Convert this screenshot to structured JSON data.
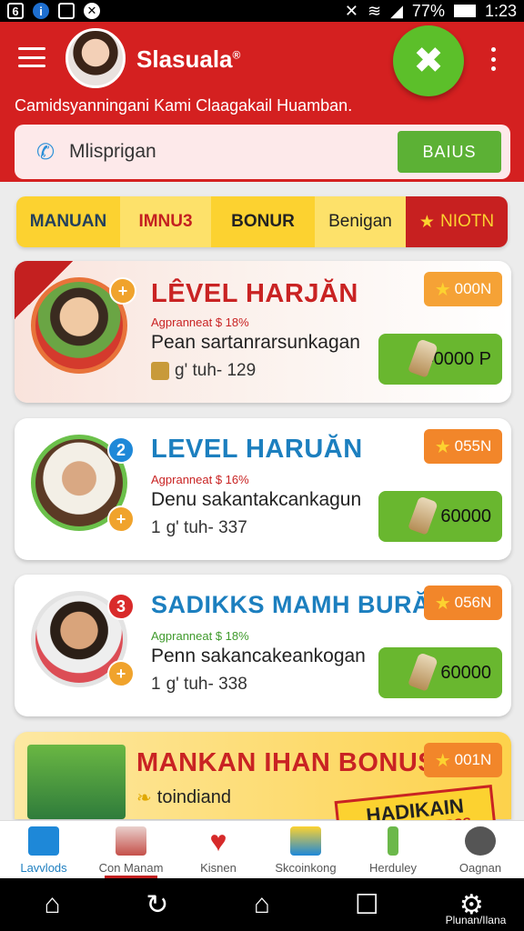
{
  "status_bar": {
    "left_icons": [
      "sim-icon",
      "info-icon",
      "gallery-icon",
      "close-circle-icon"
    ],
    "battery": "77%",
    "time": "1:23"
  },
  "header": {
    "app_title": "Slasuala",
    "app_title_mark": "®",
    "tagline": "Camidsyanningani Kami Claagakail Huamban.",
    "search_value": "Mlisprigan",
    "search_button": "BAIUS"
  },
  "tabs": [
    {
      "label": "MANUAN"
    },
    {
      "label": "IMNU3"
    },
    {
      "label": "BONUR"
    },
    {
      "label": "Benigan"
    },
    {
      "label": "NIOTN",
      "icon": "star-icon"
    }
  ],
  "cards": [
    {
      "title": "LÊVEL HARJĂN",
      "badge": "+",
      "subtitle": "Agpranneat $ 18%",
      "description": "Pean sartanrarsunkagan",
      "meta": "g' tuh- 129",
      "star_pill": "000N",
      "price": "40000 P"
    },
    {
      "title": "LEVEL HARUĂN",
      "badge": "2",
      "badge2": "+",
      "subtitle": "Agpranneat $ 16%",
      "description": "Denu sakantakcankagun",
      "meta_prefix": "1",
      "meta": "g' tuh- 337",
      "star_pill": "055N",
      "price": "60000"
    },
    {
      "title": "SADIKKS MAMH BURĂN",
      "badge": "3",
      "badge2": "+",
      "subtitle": "Agpranneat $ 18%",
      "description": "Penn sakancakeankogan",
      "meta_prefix": "1",
      "meta": "g' tuh- 338",
      "star_pill": "056N",
      "price": "60000"
    },
    {
      "title": "MANKAN IHAN BONUS",
      "description": "toindiand",
      "star_pill": "001N",
      "promo_line1": "HADIKAIN",
      "promo_line2": "AUSOANMENBSS"
    }
  ],
  "bottom_nav": [
    {
      "label": "Lavvlods",
      "icon": "home-icon"
    },
    {
      "label": "Con Manam",
      "icon": "box-icon"
    },
    {
      "label": "Kisnen",
      "icon": "heart-icon"
    },
    {
      "label": "Skcoinkong",
      "icon": "cube-icon"
    },
    {
      "label": "Herduley",
      "icon": "bar-icon"
    },
    {
      "label": "Oagnan",
      "icon": "bomb-icon"
    }
  ],
  "system_nav": {
    "right_label": "Plunan/Ilana"
  },
  "colors": {
    "header_red": "#d42020",
    "action_green": "#5cb135",
    "tab_yellow": "#fcd230",
    "pill_orange": "#f2862a",
    "title_blue": "#1c7fbf"
  }
}
